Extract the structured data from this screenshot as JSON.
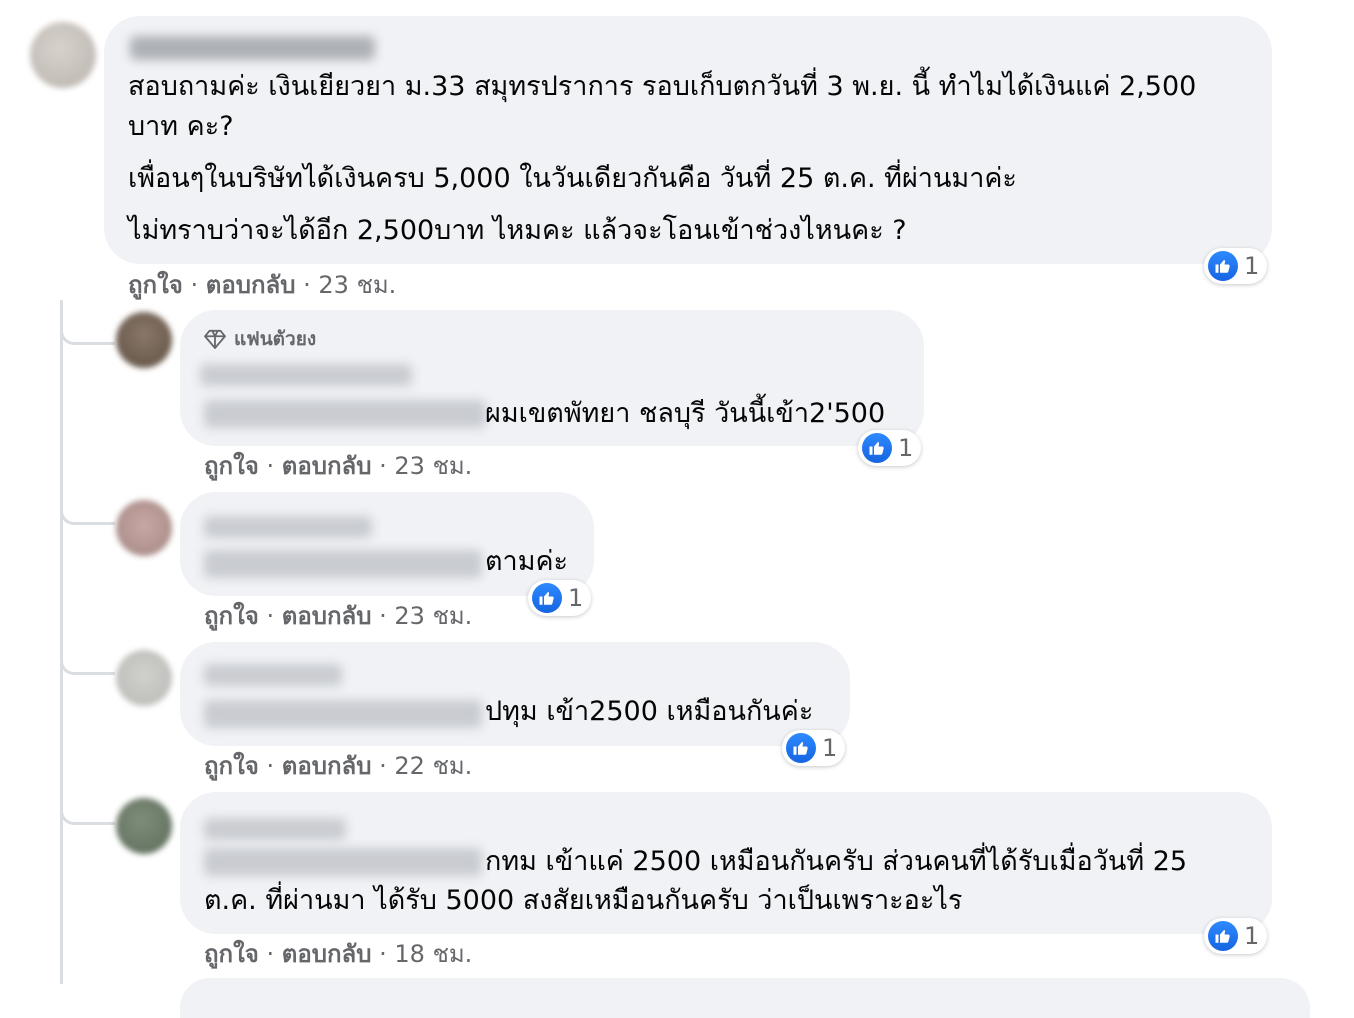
{
  "meta": {
    "like": "ถูกใจ",
    "reply": "ตอบกลับ",
    "sep": "·"
  },
  "main_comment": {
    "lines": [
      "สอบถามค่ะ เงินเยียวยา ม.33 สมุทรปราการ รอบเก็บตกวันที่ 3 พ.ย. นี้ ทำไมได้เงินแค่ 2,500",
      "บาท คะ?",
      "เพื่อนๆในบริษัทได้เงินครบ 5,000 ในวันเดียวกันคือ วันที่ 25 ต.ค. ที่ผ่านมาค่ะ",
      "ไม่ทราบว่าจะได้อีก 2,500บาท ไหมคะ แล้วจะโอนเข้าช่วงไหนคะ ?"
    ],
    "time": "23 ชม.",
    "reactions": "1"
  },
  "replies": [
    {
      "badge": "แฟนตัวยง",
      "text": "ผมเขตพัทยา ชลบุรี วันนี้เข้า2'500",
      "time": "23 ชม.",
      "reactions": "1"
    },
    {
      "text": "ตามค่ะ",
      "time": "23 ชม.",
      "reactions": "1"
    },
    {
      "text": "ปทุม เข้า2500 เหมือนกันค่ะ",
      "time": "22 ชม.",
      "reactions": "1"
    },
    {
      "lines": [
        "กทม เข้าแค่ 2500 เหมือนกันครับ ส่วนคนที่ได้รับเมื่อวันที่ 25",
        "ต.ค. ที่ผ่านมา ได้รับ 5000 สงสัยเหมือนกันครับ ว่าเป็นเพราะอะไร"
      ],
      "time": "18 ชม.",
      "reactions": "1"
    }
  ],
  "icons": {
    "like": "like-thumb-icon",
    "badge": "diamond-icon"
  }
}
